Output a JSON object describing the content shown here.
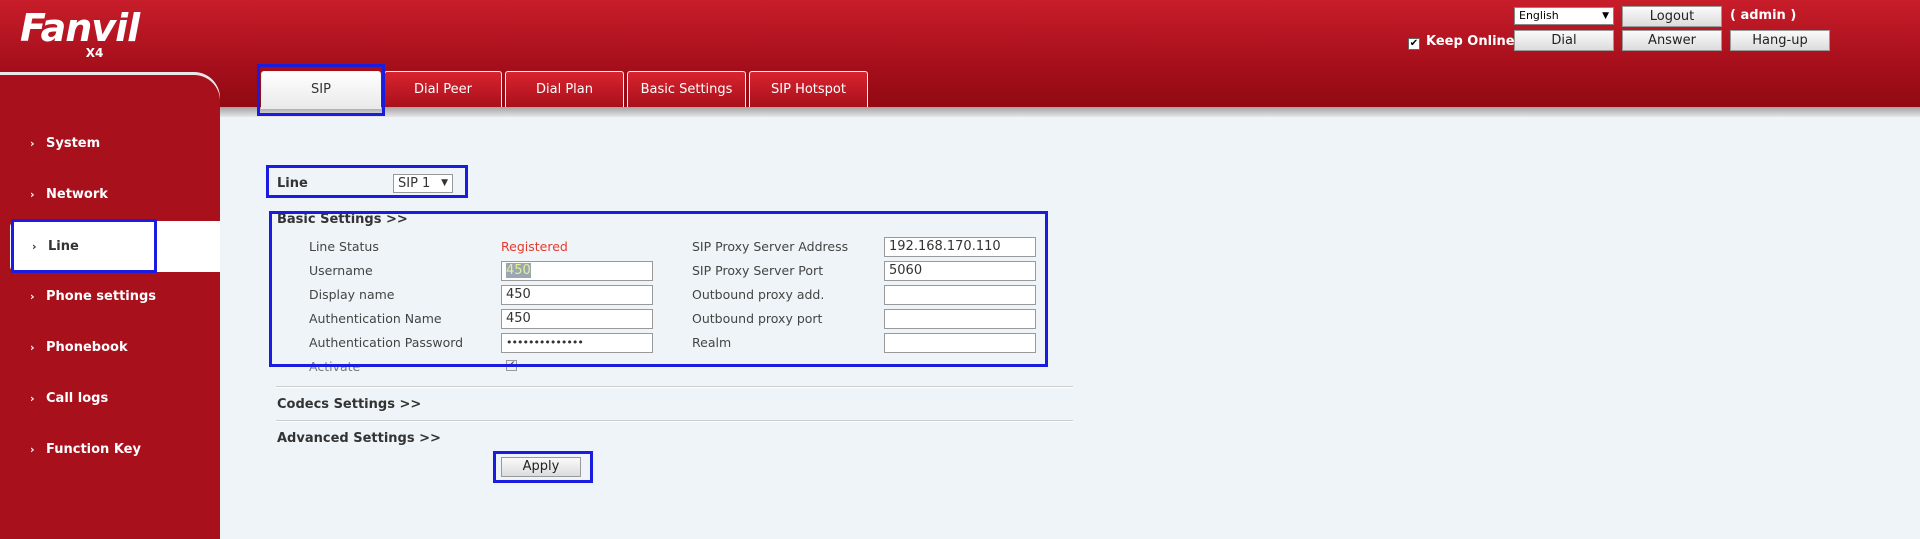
{
  "header": {
    "logo": "Fanvil",
    "model": "X4",
    "language": "English",
    "logout_label": "Logout",
    "admin_label": "( admin )",
    "keep_online_label": "Keep Online",
    "dial_label": "Dial",
    "answer_label": "Answer",
    "hangup_label": "Hang-up"
  },
  "tabs": [
    {
      "label": "SIP",
      "active": true
    },
    {
      "label": "Dial Peer"
    },
    {
      "label": "Dial Plan"
    },
    {
      "label": "Basic Settings"
    },
    {
      "label": "SIP Hotspot"
    }
  ],
  "sidebar": {
    "items": [
      {
        "label": "System"
      },
      {
        "label": "Network"
      },
      {
        "label": "Line",
        "active": true
      },
      {
        "label": "Phone settings"
      },
      {
        "label": "Phonebook"
      },
      {
        "label": "Call logs"
      },
      {
        "label": "Function Key"
      }
    ]
  },
  "form": {
    "line_label": "Line",
    "line_value": "SIP 1",
    "basic_settings_title": "Basic Settings >>",
    "codecs_settings_title": "Codecs Settings >>",
    "advanced_settings_title": "Advanced Settings >>",
    "fields": {
      "line_status": {
        "label": "Line Status",
        "value": "Registered"
      },
      "username": {
        "label": "Username",
        "value": "450"
      },
      "display_name": {
        "label": "Display name",
        "value": "450"
      },
      "auth_name": {
        "label": "Authentication Name",
        "value": "450"
      },
      "auth_password": {
        "label": "Authentication Password",
        "value": "••••••••••••••"
      },
      "activate": {
        "label": "Activate",
        "checked": true
      },
      "proxy_address": {
        "label": "SIP Proxy Server Address",
        "value": "192.168.170.110"
      },
      "proxy_port": {
        "label": "SIP Proxy Server Port",
        "value": "5060"
      },
      "outbound_addr": {
        "label": "Outbound proxy add.",
        "value": ""
      },
      "outbound_port": {
        "label": "Outbound proxy port",
        "value": ""
      },
      "realm": {
        "label": "Realm",
        "value": ""
      }
    },
    "apply_label": "Apply"
  },
  "colors": {
    "brand_red": "#a8101b",
    "status_red": "#e53a2e",
    "highlight_blue": "#1a1de0",
    "content_bg": "#eef4f7"
  }
}
